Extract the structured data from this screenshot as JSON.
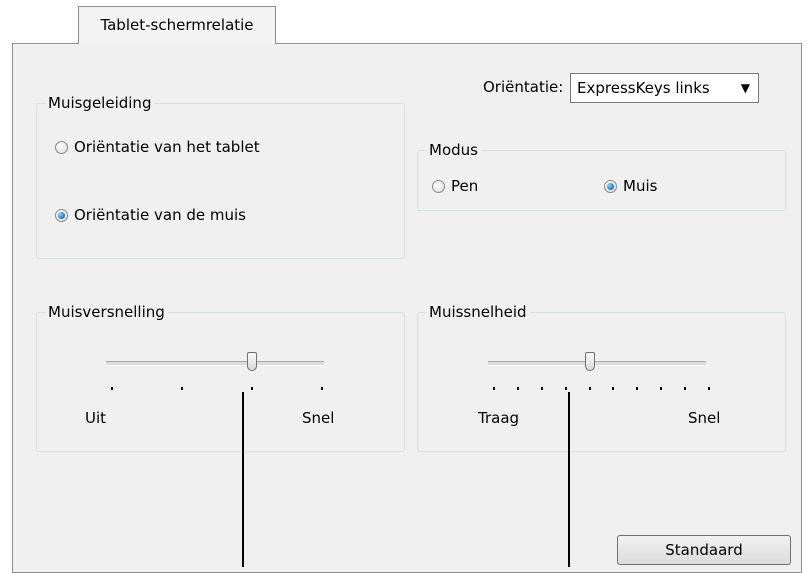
{
  "tab": {
    "label": "Tablet-schermrelatie"
  },
  "orientation": {
    "label": "Oriëntatie:",
    "selected": "ExpressKeys links"
  },
  "mouse_guidance": {
    "title": "Muisgeleiding",
    "options": [
      {
        "label": "Oriëntatie van het tablet",
        "selected": false
      },
      {
        "label": "Oriëntatie van de muis",
        "selected": true
      }
    ]
  },
  "mode": {
    "title": "Modus",
    "options": [
      {
        "label": "Pen",
        "selected": false
      },
      {
        "label": "Muis",
        "selected": true
      }
    ]
  },
  "acceleration": {
    "title": "Muisversnelling",
    "min_label": "Uit",
    "max_label": "Snel",
    "tick_count": 4,
    "value_step": 3
  },
  "speed": {
    "title": "Muissnelheid",
    "min_label": "Traag",
    "max_label": "Snel",
    "tick_count": 10,
    "value_step": 5
  },
  "default_button": {
    "label": "Standaard"
  }
}
